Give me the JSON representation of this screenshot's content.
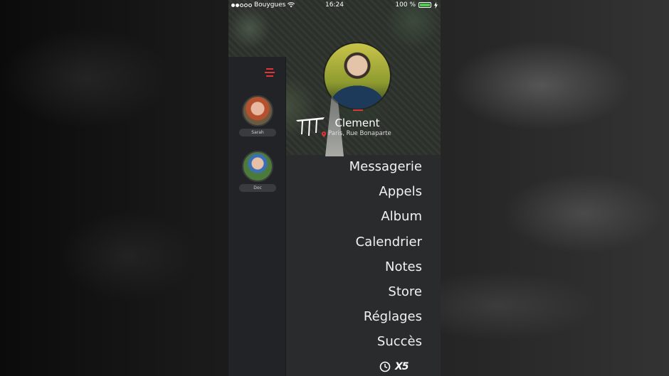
{
  "status_bar": {
    "carrier": "Bouygues",
    "time": "16:24",
    "battery": "100 %",
    "signal_dots_filled": 2,
    "signal_dots_total": 5
  },
  "profile": {
    "name": "Clement",
    "location": "Paris, Rue Bonaparte"
  },
  "contacts": [
    {
      "name": "Sarah"
    },
    {
      "name": "Doc"
    }
  ],
  "menu": [
    "Messagerie",
    "Appels",
    "Album",
    "Calendrier",
    "Notes",
    "Store",
    "Réglages",
    "Succès"
  ],
  "footer": {
    "badge_text": "X5"
  },
  "colors": {
    "accent": "#e0343a",
    "panel": "#2a2b2d",
    "sidebar": "#222326",
    "text": "#f2f2f2"
  },
  "icons": [
    "hamburger-menu-icon",
    "wifi-icon",
    "battery-icon",
    "location-pin-icon",
    "clock-icon",
    "app-logo-icon"
  ]
}
